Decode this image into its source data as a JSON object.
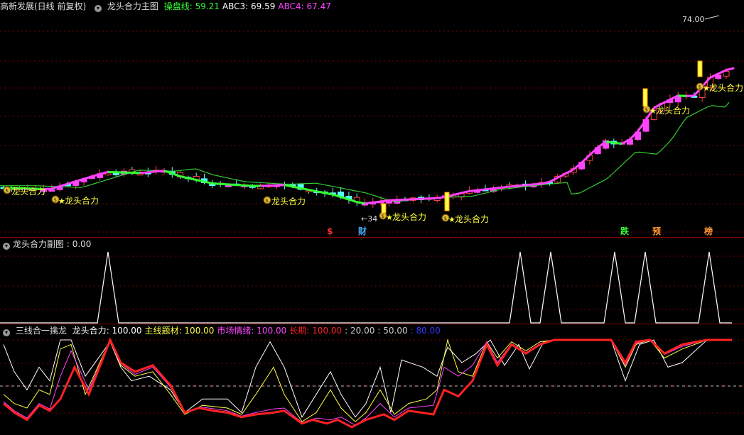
{
  "main_pane": {
    "stock_label": "高新发展(日线 前复权)",
    "indicator_name": "龙头合力主图",
    "values": [
      {
        "label": "操盘线",
        "value": "59.21",
        "color": "#33ff33"
      },
      {
        "label": "ABC3",
        "value": "69.59",
        "color": "#ffffff"
      },
      {
        "label": "ABC4",
        "value": "67.47",
        "color": "#ff44ff"
      }
    ],
    "high_price": "74.00",
    "low_price": "34",
    "signal_text": "龙头合力",
    "signals": [
      {
        "text": "龙头合力",
        "star": false
      },
      {
        "text": "龙头合力",
        "star": true
      },
      {
        "text": "龙头合力",
        "star": false
      },
      {
        "text": "龙头合力",
        "star": true
      },
      {
        "text": "龙头合力",
        "star": true
      },
      {
        "text": "龙头合力",
        "star": true
      },
      {
        "text": "龙头合力",
        "star": true
      }
    ],
    "events": [
      {
        "text": "$",
        "color": "#ff3333"
      },
      {
        "text": "财",
        "color": "#44aaff"
      },
      {
        "text": "跌",
        "color": "#33ff33"
      },
      {
        "text": "预",
        "color": "#ff9933"
      },
      {
        "text": "榜",
        "color": "#ff9933"
      }
    ],
    "colors": {
      "up": "#ff44ff",
      "down": "#55ffff",
      "ma": "#33cc33",
      "signal": "#ffff44"
    }
  },
  "sub_pane1": {
    "title": "龙头合力副图",
    "value": "0.00"
  },
  "sub_pane2": {
    "title": "三线合一擒龙",
    "values": [
      {
        "label": "龙头合力",
        "value": "100.00",
        "color": "#ffffff"
      },
      {
        "label": "主线题材",
        "value": "100.00",
        "color": "#ffff44"
      },
      {
        "label": "市场情绪",
        "value": "100.00",
        "color": "#ff44ff"
      },
      {
        "label": "长期",
        "value": "100.00",
        "color": "#ff2222"
      },
      {
        "label": "",
        "value": "20.00",
        "color": "#cccccc"
      },
      {
        "label": "",
        "value": "50.00",
        "color": "#cccccc"
      },
      {
        "label": "",
        "value": "80.00",
        "color": "#3333ff"
      }
    ]
  }
}
